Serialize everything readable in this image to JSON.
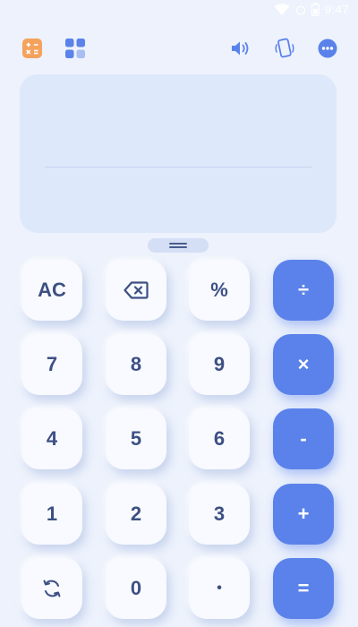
{
  "status": {
    "time": "9:47"
  },
  "toolbar": {
    "left": [
      "calculator-mode-icon",
      "apps-grid-icon"
    ],
    "right": [
      "sound-icon",
      "vibration-icon",
      "more-icon"
    ]
  },
  "display": {
    "expression": "",
    "result": ""
  },
  "keypad": {
    "ac": "AC",
    "percent": "%",
    "divide": "÷",
    "seven": "7",
    "eight": "8",
    "nine": "9",
    "multiply": "×",
    "four": "4",
    "five": "5",
    "six": "6",
    "minus": "-",
    "one": "1",
    "two": "2",
    "three": "3",
    "plus": "+",
    "zero": "0",
    "decimal": "•",
    "equals": "="
  },
  "colors": {
    "background": "#edf2fc",
    "display": "#dde8fb",
    "key": "#f8faff",
    "key_text": "#3d5083",
    "accent": "#5a82ea",
    "icon_orange": "#f5a25d"
  }
}
